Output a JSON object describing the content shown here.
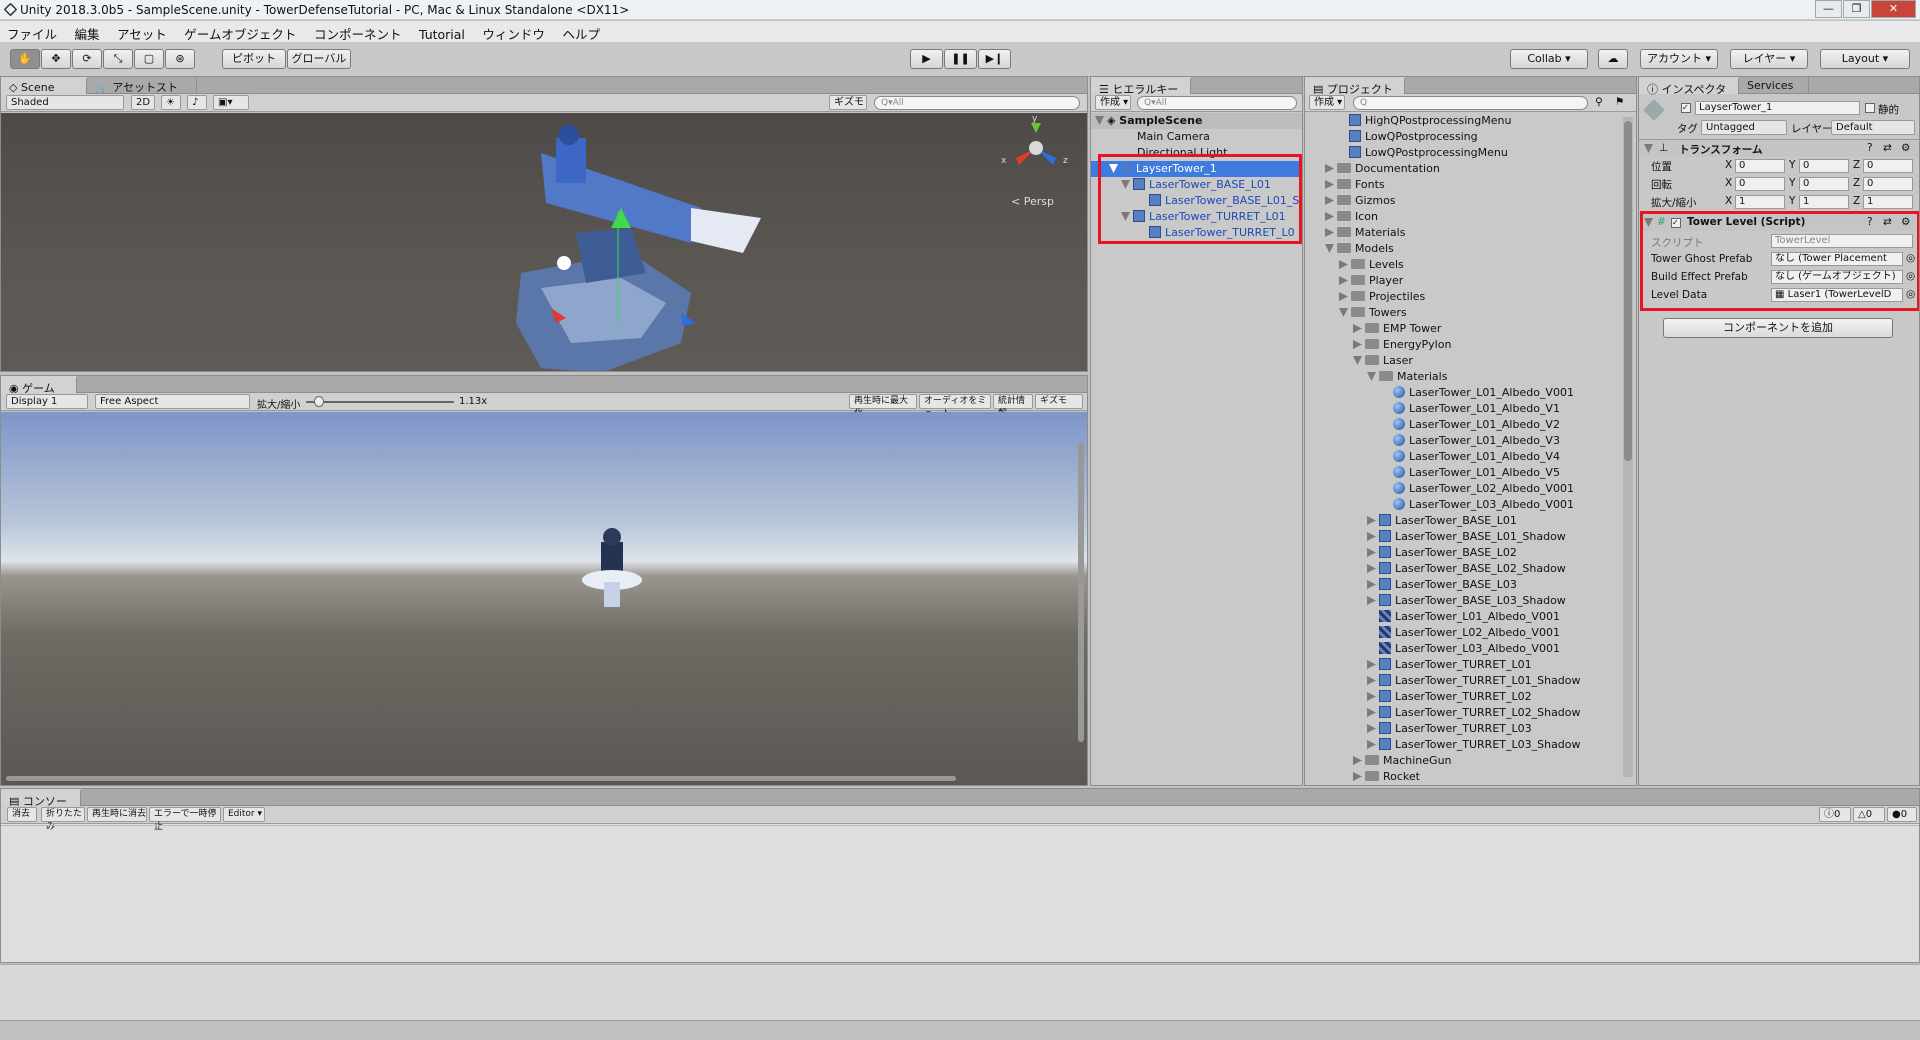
{
  "title": "Unity 2018.3.0b5 - SampleScene.unity - TowerDefenseTutorial - PC, Mac & Linux Standalone <DX11>",
  "window_buttons": [
    "—",
    "❐",
    "✕"
  ],
  "menu": [
    "ファイル",
    "編集",
    "アセット",
    "ゲームオブジェクト",
    "コンポーネント",
    "Tutorial",
    "ウィンドウ",
    "ヘルプ"
  ],
  "toolbar": {
    "pivot": "ピボット",
    "global": "グローバル",
    "collab": "Collab",
    "account": "アカウント",
    "layers": "レイヤー",
    "layout": "Layout"
  },
  "scene": {
    "tab_scene": "Scene",
    "tab_asset_store": "アセットストア",
    "shading": "Shaded",
    "mode_2d": "2D",
    "gizmos": "ギズモ",
    "search_placeholder": "Q▾All",
    "persp": "< Persp"
  },
  "game": {
    "tab": "ゲーム",
    "display": "Display 1",
    "aspect": "Free Aspect",
    "scale_label": "拡大/縮小",
    "scale_value": "1.13x",
    "maximize": "再生時に最大化",
    "mute": "オーディオをミュート",
    "stats": "統計情報",
    "gizmos": "ギズモ"
  },
  "hierarchy": {
    "tab": "ヒエラルキー",
    "create": "作成 ▾",
    "search_placeholder": "Q▾All",
    "scene_name": "SampleScene",
    "items": [
      {
        "label": "Main Camera"
      },
      {
        "label": "Directional Light"
      },
      {
        "label": "LayserTower_1"
      },
      {
        "label": "LaserTower_BASE_L01"
      },
      {
        "label": "LaserTower_BASE_L01_S"
      },
      {
        "label": "LaserTower_TURRET_L01"
      },
      {
        "label": "LaserTower_TURRET_L0"
      }
    ]
  },
  "project": {
    "tab": "プロジェクト",
    "create": "作成 ▾",
    "items": [
      {
        "label": "HighQPostprocessingMenu"
      },
      {
        "label": "LowQPostprocessing"
      },
      {
        "label": "LowQPostprocessingMenu"
      },
      {
        "label": "Documentation"
      },
      {
        "label": "Fonts"
      },
      {
        "label": "Gizmos"
      },
      {
        "label": "Icon"
      },
      {
        "label": "Materials"
      },
      {
        "label": "Models"
      },
      {
        "label": "Levels"
      },
      {
        "label": "Player"
      },
      {
        "label": "Projectiles"
      },
      {
        "label": "Towers"
      },
      {
        "label": "EMP Tower"
      },
      {
        "label": "EnergyPylon"
      },
      {
        "label": "Laser"
      },
      {
        "label": "Materials"
      },
      {
        "label": "LaserTower_L01_Albedo_V001"
      },
      {
        "label": "LaserTower_L01_Albedo_V1"
      },
      {
        "label": "LaserTower_L01_Albedo_V2"
      },
      {
        "label": "LaserTower_L01_Albedo_V3"
      },
      {
        "label": "LaserTower_L01_Albedo_V4"
      },
      {
        "label": "LaserTower_L01_Albedo_V5"
      },
      {
        "label": "LaserTower_L02_Albedo_V001"
      },
      {
        "label": "LaserTower_L03_Albedo_V001"
      },
      {
        "label": "LaserTower_BASE_L01"
      },
      {
        "label": "LaserTower_BASE_L01_Shadow"
      },
      {
        "label": "LaserTower_BASE_L02"
      },
      {
        "label": "LaserTower_BASE_L02_Shadow"
      },
      {
        "label": "LaserTower_BASE_L03"
      },
      {
        "label": "LaserTower_BASE_L03_Shadow"
      },
      {
        "label": "LaserTower_L01_Albedo_V001"
      },
      {
        "label": "LaserTower_L02_Albedo_V001"
      },
      {
        "label": "LaserTower_L03_Albedo_V001"
      },
      {
        "label": "LaserTower_TURRET_L01"
      },
      {
        "label": "LaserTower_TURRET_L01_Shadow"
      },
      {
        "label": "LaserTower_TURRET_L02"
      },
      {
        "label": "LaserTower_TURRET_L02_Shadow"
      },
      {
        "label": "LaserTower_TURRET_L03"
      },
      {
        "label": "LaserTower_TURRET_L03_Shadow"
      },
      {
        "label": "MachineGun"
      },
      {
        "label": "Rocket"
      }
    ]
  },
  "inspector": {
    "tab": "インスペクター",
    "tab_services": "Services",
    "object_name": "LayserTower_1",
    "static_label": "静的",
    "tag_label": "タグ",
    "tag_value": "Untagged",
    "layer_label": "レイヤー",
    "layer_value": "Default",
    "transform_title": "トランスフォーム",
    "position_label": "位置",
    "rotation_label": "回転",
    "scale_label": "拡大/縮小",
    "x": "X",
    "y": "Y",
    "z": "Z",
    "position": [
      "0",
      "0",
      "0"
    ],
    "rotation": [
      "0",
      "0",
      "0"
    ],
    "scale": [
      "1",
      "1",
      "1"
    ],
    "script_component_title": "Tower Level (Script)",
    "script_label": "スクリプト",
    "script_value": "TowerLevel",
    "ghost_label": "Tower Ghost Prefab",
    "ghost_value": "なし (Tower Placement",
    "effect_label": "Build Effect Prefab",
    "effect_value": "なし (ゲームオブジェクト)",
    "leveldata_label": "Level Data",
    "leveldata_value": "Laser1 (TowerLevelD",
    "add_component": "コンポーネントを追加"
  },
  "console": {
    "tab": "コンソール",
    "clear": "消去",
    "collapse": "折りたたみ",
    "clear_on_play": "再生時に消去",
    "error_pause": "エラーで一時停止",
    "editor": "Editor",
    "info_count": "0",
    "warn_count": "0",
    "error_count": "0"
  },
  "colors": {
    "selection": "#3d7be0",
    "highlight_box": "#e8141e"
  }
}
